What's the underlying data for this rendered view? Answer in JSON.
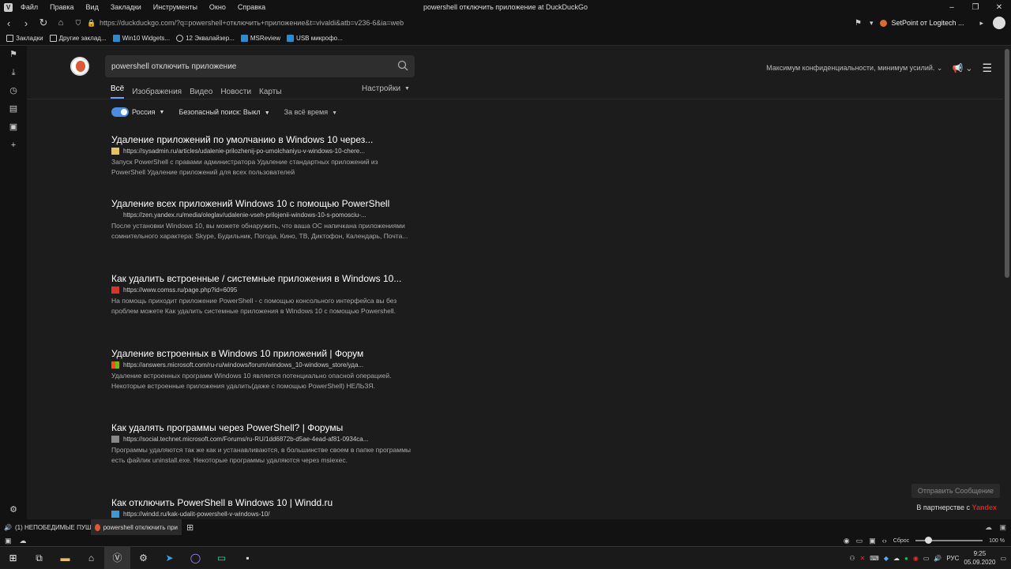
{
  "window": {
    "title": "powershell отключить приложение at DuckDuckGo",
    "menu": [
      "Файл",
      "Правка",
      "Вид",
      "Закладки",
      "Инструменты",
      "Окно",
      "Справка"
    ]
  },
  "address": {
    "url": "https://duckduckgo.com/?q=powershell+отключить+приложение&t=vivaldi&atb=v236-6&ia=web",
    "extension_label": "SetPoint от Logitech ..."
  },
  "bookmarks": [
    "Закладки",
    "Другие заклад...",
    "Win10 Widgets...",
    "12 Эквалайзер...",
    "MSReview",
    "USB микрофо..."
  ],
  "search": {
    "query": "powershell отключить приложение",
    "tabs": [
      "Всё",
      "Изображения",
      "Видео",
      "Новости",
      "Карты"
    ],
    "settings_label": "Настройки",
    "privacy_slogan": "Максимум конфиденциальности, минимум усилий.",
    "filters": {
      "region": "Россия",
      "safe_search": "Безопасный поиск: Выкл",
      "time": "За всё время"
    }
  },
  "results": [
    {
      "title": "Удаление приложений по умолчанию в Windows 10 через...",
      "url": "https://sysadmin.ru/articles/udalenie-prilozhenij-po-umolchaniyu-v-windows-10-chere...",
      "snippet": "Запуск PowerShell с правами администратора Удаление стандартных приложений из PowerShell Удаление приложений для всех пользователей",
      "favicon_color": "#e8c25a"
    },
    {
      "title": "Удаление всех приложений Windows 10 с помощью PowerShell",
      "url": "https://zen.yandex.ru/media/oleglav/udalenie-vseh-prilojenii-windows-10-s-pomosciu-...",
      "snippet": "После установки Windows 10, вы можете обнаружить, что ваша ОС напичкана приложениями сомнительного характера: Skype, Будильник, Погода, Кино, ТВ, Диктофон, Календарь, Почта...",
      "favicon_color": "#1c1c1c"
    },
    {
      "title": "Как удалить встроенные / системные приложения в Windows 10...",
      "url": "https://www.comss.ru/page.php?id=6095",
      "snippet": "На помощь приходит приложение PowerShell - с помощью консольного интерфейса вы без проблем можете Как удалить системные приложения в Windows 10 с помощью Powershell.",
      "favicon_color": "#d9342b"
    },
    {
      "title": "Удаление встроенных в Windows 10 приложений | Форум",
      "url": "https://answers.microsoft.com/ru-ru/windows/forum/windows_10-windows_store/уда...",
      "snippet": "Удаление встроенных программ Windows 10 является потенциально опасной операцией. Некоторые встроенные приложения удалить(даже с помощью PowerShell) НЕЛЬЗЯ.",
      "favicon_color": "#7fba00"
    },
    {
      "title": "Как удалять программы через PowerShell? | Форумы",
      "url": "https://social.technet.microsoft.com/Forums/ru-RU/1dd6872b-d5ae-4ead-af81-0934ca...",
      "snippet": "Программы удаляются так же как и устанавливаются, в большинстве своем в папке программы есть файлик uninstall.exe. Некоторые программы удаляются через msiexec.",
      "favicon_color": "#888888"
    },
    {
      "title": "Как отключить PowerShell в Windows 10 | Windd.ru",
      "url": "https://windd.ru/kak-udalit-powershell-v-windows-10/",
      "snippet": "",
      "favicon_color": "#3a9ad9"
    }
  ],
  "feedback_label": "Отправить Сообщение",
  "partner_label": "В партнерстве с",
  "partner_brand": "Yandex",
  "tabs": [
    {
      "label": "(1) НЕПОБЕДИМЫЕ ПУШК",
      "active": false
    },
    {
      "label": "powershell отключить при",
      "active": true
    }
  ],
  "status": {
    "reset_label": "Сброс",
    "zoom": "100 %"
  },
  "taskbar": {
    "lang": "РУС",
    "time": "9:25",
    "date": "05.09.2020"
  }
}
